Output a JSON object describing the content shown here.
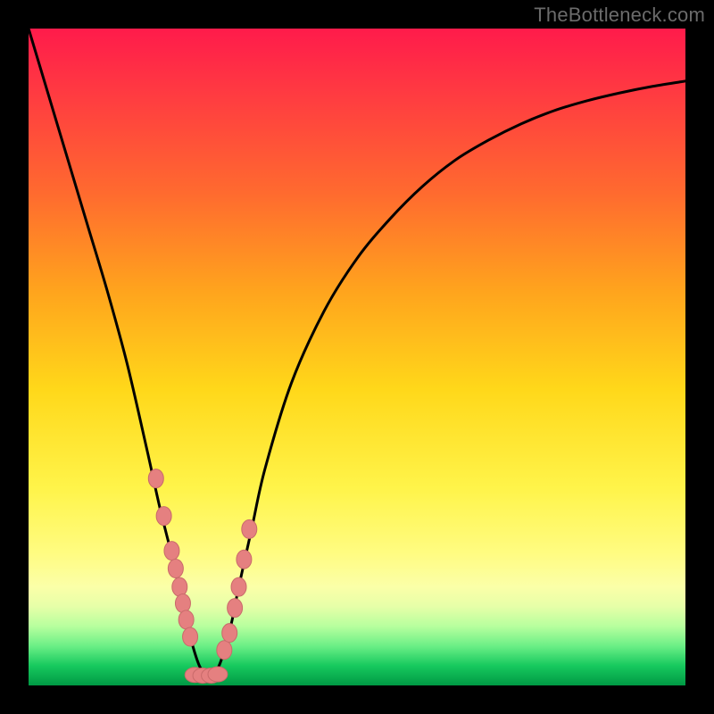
{
  "watermark": "TheBottleneck.com",
  "colors": {
    "curve": "#000000",
    "bead_fill": "#e58080",
    "bead_stroke": "#c96a6a",
    "frame": "#000000"
  },
  "chart_data": {
    "type": "line",
    "title": "",
    "xlabel": "",
    "ylabel": "",
    "xlim": [
      0,
      100
    ],
    "ylim": [
      0,
      100
    ],
    "note": "V-shaped bottleneck curve; minimum (green zone) near x≈27. Beads mark sampled points on both branches near the trough.",
    "series": [
      {
        "name": "bottleneck_curve",
        "x": [
          0,
          3,
          6,
          9,
          12,
          15,
          18,
          20,
          22,
          24,
          25,
          26,
          27,
          28,
          29,
          30,
          31,
          32,
          34,
          36,
          40,
          45,
          50,
          55,
          60,
          65,
          70,
          75,
          80,
          85,
          90,
          95,
          100
        ],
        "y": [
          100,
          90,
          80,
          70,
          60,
          49,
          36,
          27,
          19,
          10,
          6,
          3,
          1.5,
          1.5,
          3,
          6,
          10,
          15,
          24,
          33,
          46,
          57,
          65,
          71,
          76,
          80,
          83,
          85.5,
          87.5,
          89,
          90.2,
          91.2,
          92
        ]
      }
    ],
    "beads": {
      "left_branch_x": [
        19.4,
        20.6,
        21.8,
        22.4,
        23.0,
        23.5,
        24.0,
        24.6
      ],
      "left_branch_y": [
        31.5,
        25.8,
        20.5,
        17.8,
        15.0,
        12.5,
        10.0,
        7.4
      ],
      "right_branch_x": [
        29.8,
        30.6,
        31.4,
        32.0,
        32.8,
        33.6
      ],
      "right_branch_y": [
        5.4,
        8.0,
        11.8,
        15.0,
        19.2,
        23.8
      ],
      "trough_x": [
        25.3,
        26.5,
        27.8,
        28.8
      ],
      "trough_y": [
        1.6,
        1.5,
        1.5,
        1.7
      ]
    }
  }
}
